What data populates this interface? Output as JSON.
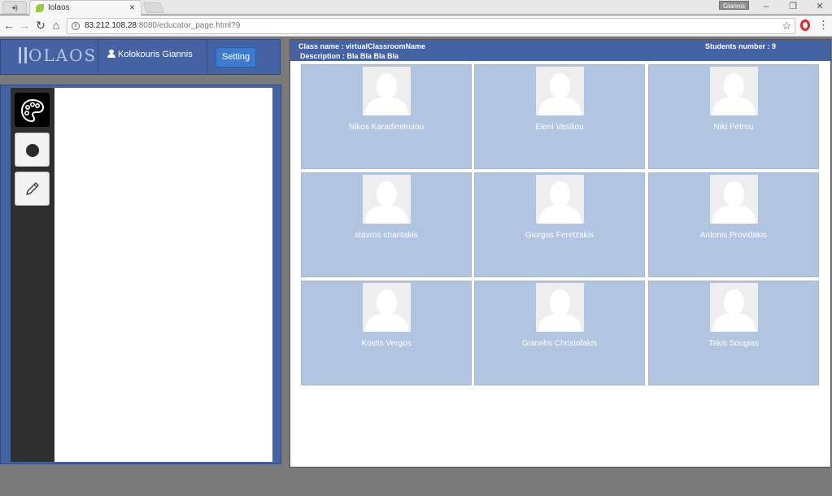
{
  "browser": {
    "tab_title": "Iolaos",
    "window_user": "Giannis",
    "url_host": "83.212.108.28",
    "url_rest": ":8080/educator_page.html?9"
  },
  "header": {
    "logo": "OLAOS",
    "user_name": "Kolokouris Giannis",
    "setting_label": "Setting"
  },
  "tools": [
    {
      "icon": "palette-icon",
      "active": true
    },
    {
      "icon": "dot-icon",
      "active": false
    },
    {
      "icon": "pencil-icon",
      "active": false
    }
  ],
  "class_info": {
    "name": "Class name : virtualClassroomName",
    "description": "Description : Bla Bla Bla Bla",
    "students_number": "Students number : 9"
  },
  "students": [
    "Nikos Karadimitruiou",
    "Eleni Vasiliou",
    "Niki Petrou",
    "stavros charitakis",
    "Giorgos Feretzakis",
    "Antonis Providakis",
    "Kostis Vergos",
    "Giannhs Christofakis",
    "Takis Sougias"
  ],
  "colors": {
    "header_blue": "#4563a3",
    "card_blue": "#b1c4e0",
    "button_blue": "#3a7bd0"
  }
}
